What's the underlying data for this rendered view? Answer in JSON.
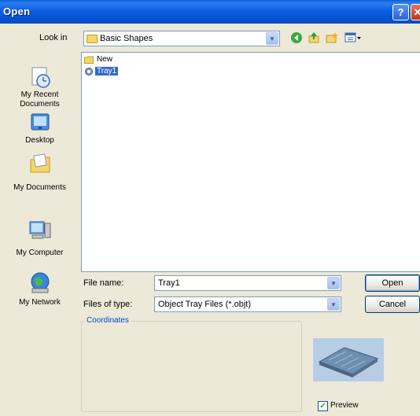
{
  "window": {
    "title": "Open",
    "help_label": "?",
    "close_label": "✕"
  },
  "lookin": {
    "label": "Look in",
    "value": "Basic Shapes"
  },
  "toolbar": {
    "back_icon": "back-icon",
    "up_icon": "up-folder-icon",
    "newfolder_icon": "new-folder-icon",
    "views_icon": "views-menu-icon"
  },
  "places": [
    {
      "label": "My Recent Documents",
      "icon": "recent-documents-icon"
    },
    {
      "label": "Desktop",
      "icon": "desktop-icon"
    },
    {
      "label": "My Documents",
      "icon": "my-documents-icon"
    },
    {
      "label": "My Computer",
      "icon": "my-computer-icon"
    },
    {
      "label": "My Network",
      "icon": "my-network-icon"
    }
  ],
  "files": [
    {
      "name": "New",
      "icon": "folder-icon",
      "selected": false
    },
    {
      "name": "Tray1",
      "icon": "tray-file-icon",
      "selected": true
    }
  ],
  "filename": {
    "label": "File name:",
    "value": "Tray1"
  },
  "filetype": {
    "label": "Files of type:",
    "value": "Object Tray Files (*.objt)"
  },
  "buttons": {
    "open": "Open",
    "cancel": "Cancel"
  },
  "coordinates": {
    "label": "Coordinates"
  },
  "preview": {
    "label": "Preview",
    "checked": true
  }
}
